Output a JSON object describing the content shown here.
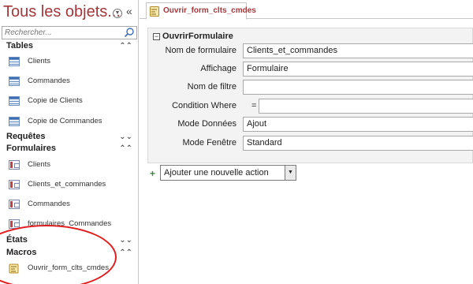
{
  "nav": {
    "title": "Tous les objets...",
    "search_placeholder": "Rechercher...",
    "groups": [
      {
        "label": "Tables",
        "chevron": "⌃",
        "items": [
          "Clients",
          "Commandes",
          "Copie de Clients",
          "Copie de Commandes"
        ]
      },
      {
        "label": "Requêtes",
        "chevron": "⌄",
        "items": []
      },
      {
        "label": "Formulaires",
        "chevron": "⌃",
        "items": [
          "Clients",
          "Clients_et_commandes",
          "Commandes",
          "formulaires_Commandes"
        ]
      },
      {
        "label": "États",
        "chevron": "⌄",
        "items": []
      },
      {
        "label": "Macros",
        "chevron": "⌃",
        "items": [
          "Ouvrir_form_clts_cmdes"
        ]
      }
    ]
  },
  "tab": {
    "label": "Ouvrir_form_clts_cmdes"
  },
  "macro": {
    "action": "OuvrirFormulaire",
    "arguments": [
      {
        "label": "Nom de formulaire",
        "value": "Clients_et_commandes"
      },
      {
        "label": "Affichage",
        "value": "Formulaire"
      },
      {
        "label": "Nom de filtre",
        "value": ""
      },
      {
        "label": "Condition Where",
        "value": ""
      },
      {
        "label": "Mode Données",
        "value": "Ajout"
      },
      {
        "label": "Mode Fenêtre",
        "value": "Standard"
      }
    ],
    "where_prefix": "=",
    "add_action": "Ajouter une nouvelle action"
  },
  "colors": {
    "accent": "#a4373a",
    "highlight": "#e01e1e"
  }
}
